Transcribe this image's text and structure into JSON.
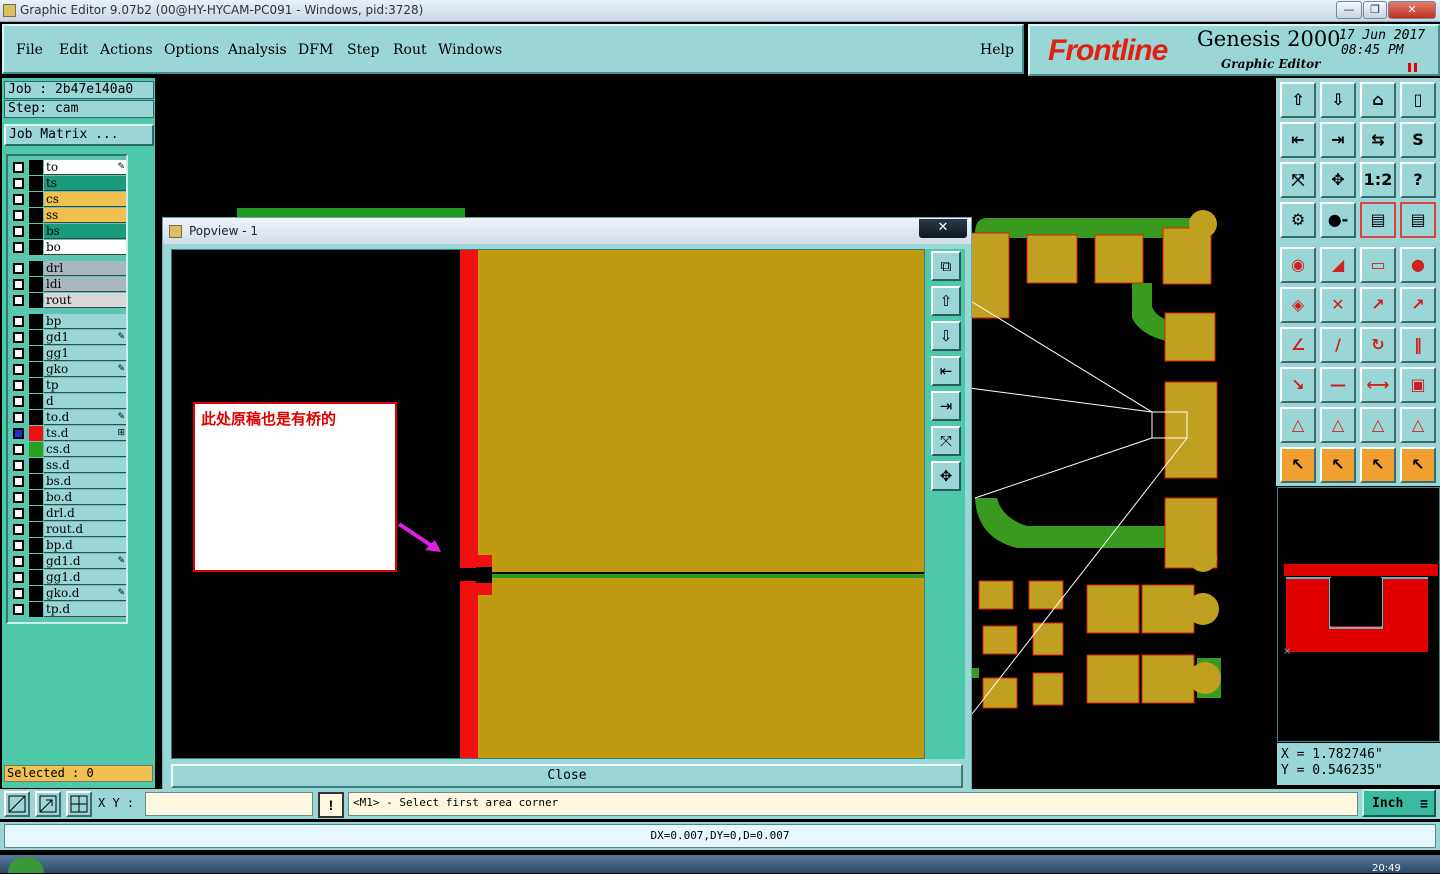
{
  "window": {
    "title": "Graphic Editor 9.07b2 (00@HY-HYCAM-PC091 - Windows, pid:3728)",
    "minimize": "—",
    "maximize": "❐",
    "close": "✕"
  },
  "menu": {
    "items": [
      "File",
      "Edit",
      "Actions",
      "Options",
      "Analysis",
      "DFM",
      "Step",
      "Rout",
      "Windows"
    ],
    "help": "Help"
  },
  "brand": {
    "logo": "Frontline",
    "product": "Genesis 2000",
    "subtitle": "Graphic Editor",
    "date": "17  Jun  2017",
    "time": "08:45  PM"
  },
  "job": {
    "job_line": "Job  :  2b47e140a0",
    "step_line": "Step:  cam",
    "matrix_button": "Job Matrix ..."
  },
  "layers": [
    {
      "name": "to",
      "color": "#ffffff",
      "icon": "✎"
    },
    {
      "name": "ts",
      "color": "#1a9c7c",
      "icon": ""
    },
    {
      "name": "cs",
      "color": "#f0c050",
      "icon": ""
    },
    {
      "name": "ss",
      "color": "#f0c050",
      "icon": ""
    },
    {
      "name": "bs",
      "color": "#1a9c7c",
      "icon": ""
    },
    {
      "name": "bo",
      "color": "#ffffff",
      "icon": ""
    },
    {
      "name": "drl",
      "color": "#a8b8c0",
      "icon": ""
    },
    {
      "name": "ldi",
      "color": "#a8b8c0",
      "icon": ""
    },
    {
      "name": "rout",
      "color": "#d8d8d8",
      "icon": ""
    },
    {
      "name": "bp",
      "color": "#9ad6d6",
      "icon": ""
    },
    {
      "name": "gd1",
      "color": "#9ad6d6",
      "icon": "✎"
    },
    {
      "name": "gg1",
      "color": "#9ad6d6",
      "icon": ""
    },
    {
      "name": "gko",
      "color": "#9ad6d6",
      "icon": "✎"
    },
    {
      "name": "tp",
      "color": "#9ad6d6",
      "icon": ""
    },
    {
      "name": "d",
      "color": "#9ad6d6",
      "icon": ""
    },
    {
      "name": "to.d",
      "color": "#9ad6d6",
      "icon": "✎"
    },
    {
      "name": "ts.d",
      "color": "#9ad6d6",
      "icon": "⊞"
    },
    {
      "name": "cs.d",
      "color": "#9ad6d6",
      "icon": ""
    },
    {
      "name": "ss.d",
      "color": "#9ad6d6",
      "icon": ""
    },
    {
      "name": "bs.d",
      "color": "#9ad6d6",
      "icon": ""
    },
    {
      "name": "bo.d",
      "color": "#9ad6d6",
      "icon": ""
    },
    {
      "name": "drl.d",
      "color": "#9ad6d6",
      "icon": ""
    },
    {
      "name": "rout.d",
      "color": "#9ad6d6",
      "icon": ""
    },
    {
      "name": "bp.d",
      "color": "#9ad6d6",
      "icon": ""
    },
    {
      "name": "gd1.d",
      "color": "#9ad6d6",
      "icon": "✎"
    },
    {
      "name": "gg1.d",
      "color": "#9ad6d6",
      "icon": ""
    },
    {
      "name": "gko.d",
      "color": "#9ad6d6",
      "icon": "✎"
    },
    {
      "name": "tp.d",
      "color": "#9ad6d6",
      "icon": ""
    }
  ],
  "selected": "Selected : 0",
  "popup": {
    "title": "Popview - 1",
    "close_label": "Close",
    "annotation": "此处原稿也是有桥的"
  },
  "coords": {
    "x": "X  =  1.782746\"",
    "y": "Y  =  0.546235\""
  },
  "bottom": {
    "xy_label": "X Y :",
    "prompt": "<M1> - Select first area corner",
    "units": "Inch",
    "status": "DX=0.007,DY=0,D=0.007"
  },
  "taskbar": {
    "clock": "20:49"
  }
}
